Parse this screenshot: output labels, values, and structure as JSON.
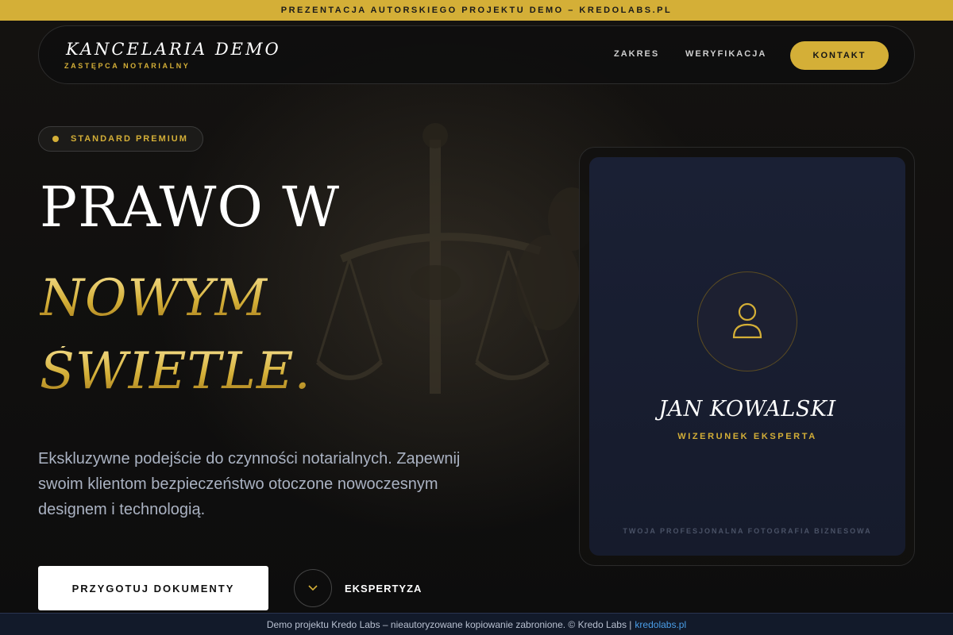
{
  "banner": {
    "text": "PREZENTACJA AUTORSKIEGO PROJEKTU DEMO – KREDOLABS.PL"
  },
  "nav": {
    "brand_title": "KANCELARIA DEMO",
    "brand_subtitle": "ZASTĘPCA NOTARIALNY",
    "links": [
      "ZAKRES",
      "WERYFIKACJA"
    ],
    "cta_label": "KONTAKT"
  },
  "hero": {
    "badge_text": "STANDARD PREMIUM",
    "headline_line1": "PRAWO W",
    "headline_line2": "NOWYM",
    "headline_line3": "ŚWIETLE.",
    "description": "Ekskluzywne podejście do czynności notarialnych. Zapewnij swoim klientom bezpieczeństwo otoczone nowoczesnym designem i technologią.",
    "primary_button": "PRZYGOTUJ DOKUMENTY",
    "secondary_link": "EKSPERTYZA"
  },
  "profile_card": {
    "name": "JAN KOWALSKI",
    "role": "WIZERUNEK EKSPERTA",
    "caption": "TWOJA PROFESJONALNA FOTOGRAFIA BIZNESOWA",
    "icon": "user-icon"
  },
  "footer": {
    "text": "Demo projektu Kredo Labs – nieautoryzowane kopiowanie zabronione. © Kredo Labs |",
    "link_text": "kredolabs.pl"
  },
  "colors": {
    "accent_gold": "#d4af37",
    "background": "#0c0c0c",
    "card_navy": "#1a2034",
    "footer_bg": "#121a2a",
    "footer_link": "#4a9ee8"
  }
}
